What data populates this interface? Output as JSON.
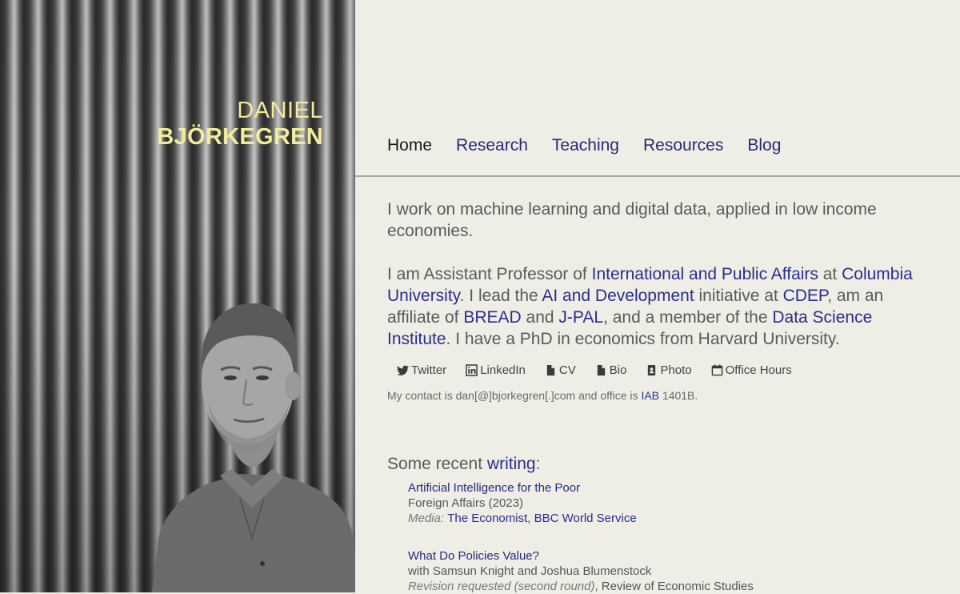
{
  "hero": {
    "first_name": "DANIEL",
    "last_name": "BJÖRKEGREN"
  },
  "nav": [
    {
      "label": "Home",
      "active": true
    },
    {
      "label": "Research",
      "active": false
    },
    {
      "label": "Teaching",
      "active": false
    },
    {
      "label": "Resources",
      "active": false
    },
    {
      "label": "Blog",
      "active": false
    }
  ],
  "intro": {
    "p1": "I work on machine learning and digital data, applied in low income economies.",
    "p2": {
      "t1": "I am Assistant Professor of ",
      "l1": "International and Public Affairs",
      "t2": " at ",
      "l2": "Columbia University",
      "t3": ". I lead the ",
      "l3": "AI and Development",
      "t4": " initiative at ",
      "l4": "CDEP",
      "t5": ", am an affiliate of ",
      "l5": "BREAD",
      "t6": " and ",
      "l6": "J-PAL",
      "t7": ", and a member of the ",
      "l7": "Data Science Institute",
      "t8": ". I have a PhD in economics from Harvard University."
    }
  },
  "social": [
    {
      "label": "Twitter",
      "icon": "twitter-icon"
    },
    {
      "label": "LinkedIn",
      "icon": "linkedin-icon"
    },
    {
      "label": "CV",
      "icon": "file-icon"
    },
    {
      "label": "Bio",
      "icon": "file-icon"
    },
    {
      "label": "Photo",
      "icon": "badge-icon"
    },
    {
      "label": "Office Hours",
      "icon": "calendar-icon"
    }
  ],
  "contact": {
    "t1": "My contact is dan[@]bjorkegren[.]com and office is ",
    "link": "IAB",
    "t2": " 1401B."
  },
  "recent": {
    "prefix": "Some recent ",
    "link": "writing",
    "suffix": ":"
  },
  "publications": [
    {
      "title": "Artificial Intelligence for the Poor",
      "sub": "Foreign Affairs (2023)",
      "meta_label": "Media: ",
      "meta_links": "The Economist, BBC World Service"
    },
    {
      "title": "What Do Policies Value?",
      "sub": "with Samsun Knight and Joshua Blumenstock",
      "meta_label": "Revision requested (second round)",
      "meta_links": ", Review of Economic Studies"
    }
  ],
  "colors": {
    "name": "#f2eb9a",
    "link": "#262b7a",
    "background": "#eeede6"
  }
}
